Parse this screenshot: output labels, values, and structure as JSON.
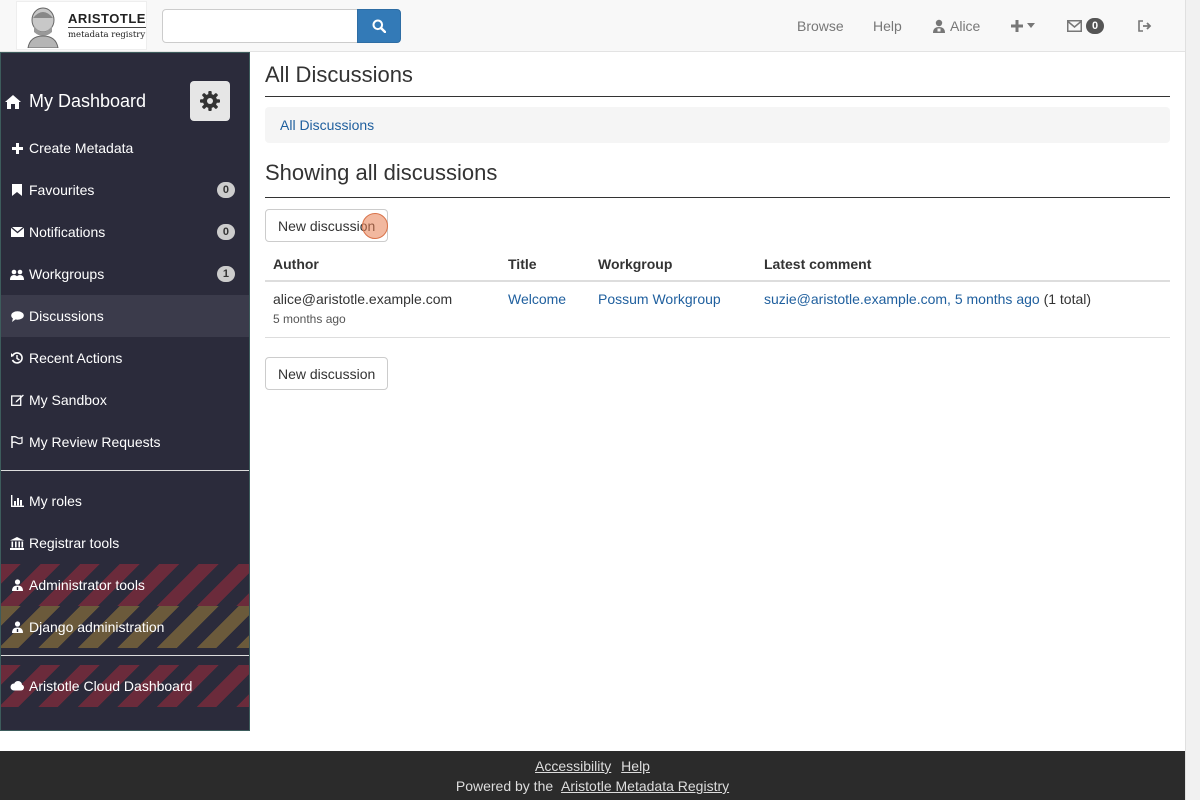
{
  "navbar": {
    "logo_title": "ARISTOTLE",
    "logo_sub": "metadata registry",
    "search_placeholder": "",
    "browse": "Browse",
    "help": "Help",
    "user": "Alice",
    "inbox_count": "0"
  },
  "sidebar": {
    "title": "My Dashboard",
    "items": [
      {
        "label": "Create Metadata",
        "icon": "plus-icon"
      },
      {
        "label": "Favourites",
        "icon": "bookmark-icon",
        "badge": "0"
      },
      {
        "label": "Notifications",
        "icon": "envelope-icon",
        "badge": "0"
      },
      {
        "label": "Workgroups",
        "icon": "users-icon",
        "badge": "1"
      },
      {
        "label": "Discussions",
        "icon": "comments-icon",
        "active": true
      },
      {
        "label": "Recent Actions",
        "icon": "history-icon"
      },
      {
        "label": "My Sandbox",
        "icon": "edit-icon"
      },
      {
        "label": "My Review Requests",
        "icon": "flag-icon"
      },
      {
        "label": "My roles",
        "icon": "chart-icon"
      },
      {
        "label": "Registrar tools",
        "icon": "bank-icon"
      },
      {
        "label": "Administrator tools",
        "icon": "user-md-icon"
      },
      {
        "label": "Django administration",
        "icon": "user-md-icon"
      },
      {
        "label": "Aristotle Cloud Dashboard",
        "icon": "cloud-icon"
      }
    ]
  },
  "main": {
    "page_title": "All Discussions",
    "breadcrumb": "All Discussions",
    "sub_title": "Showing all discussions",
    "new_discussion_label": "New discussion",
    "table": {
      "headers": [
        "Author",
        "Title",
        "Workgroup",
        "Latest comment"
      ],
      "rows": [
        {
          "author": "alice@aristotle.example.com",
          "author_time": "5 months ago",
          "title": "Welcome",
          "workgroup": "Possum Workgroup",
          "latest_comment": "suzie@aristotle.example.com, 5 months ago",
          "latest_total": "(1 total)"
        }
      ]
    }
  },
  "footer": {
    "accessibility": "Accessibility",
    "help": "Help",
    "powered_by": "Powered by the",
    "registry_link": "Aristotle Metadata Registry"
  },
  "colors": {
    "primary": "#337ab7",
    "sidebar_bg": "#2b2b3b",
    "footer_bg": "#2b2b2b",
    "link": "#1f5f9e",
    "stripe_red": "#6b2b3b",
    "stripe_orange": "#6b5a3b"
  }
}
